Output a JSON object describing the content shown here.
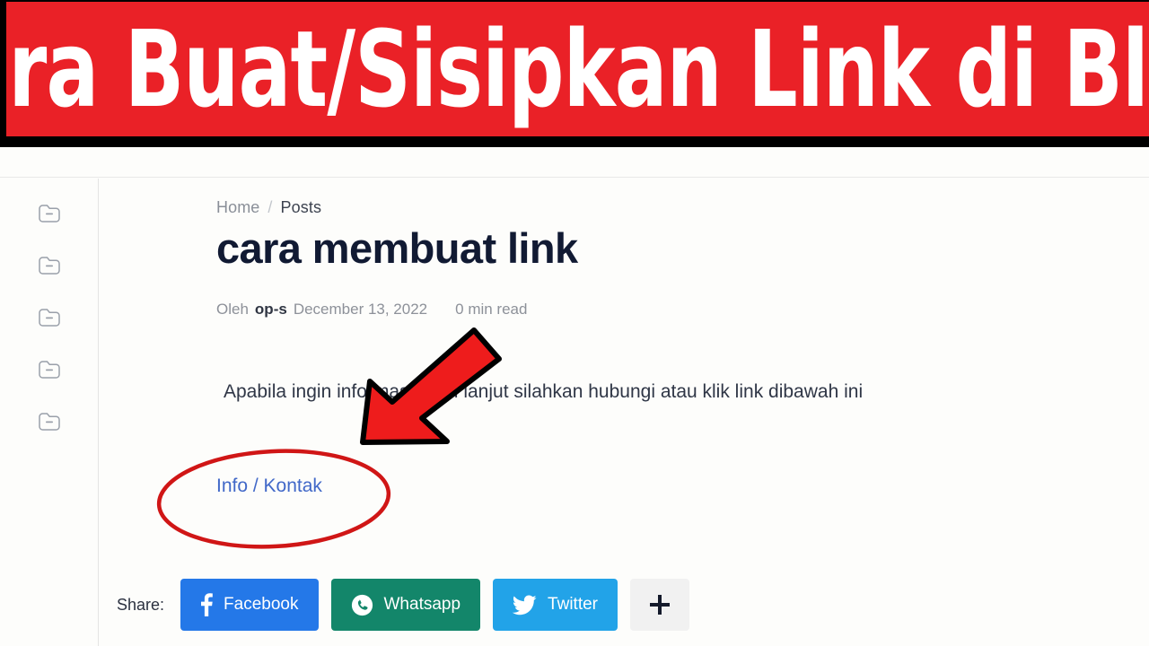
{
  "banner": {
    "text": "Cara Buat/Sisipkan Link di Blog",
    "background_color": "#ea2127",
    "text_color": "#ffffff",
    "border_color": "#000000"
  },
  "sidebar": {
    "items": [
      {
        "icon": "folder-icon"
      },
      {
        "icon": "folder-icon"
      },
      {
        "icon": "folder-icon"
      },
      {
        "icon": "folder-icon"
      },
      {
        "icon": "folder-icon"
      }
    ]
  },
  "breadcrumb": {
    "home": "Home",
    "separator": "/",
    "current": "Posts"
  },
  "post": {
    "title": "cara membuat link",
    "meta": {
      "by_label": "Oleh",
      "author": "op-s",
      "date": "December 13, 2022",
      "read_time": "0 min read"
    },
    "body": "Apabila ingin informasi lebih lanjut silahkan hubungi atau klik link dibawah ini",
    "link_text": "Info / Kontak",
    "link_color": "#4168c8"
  },
  "share": {
    "label": "Share:",
    "buttons": [
      {
        "label": "Facebook",
        "icon": "facebook-icon",
        "color": "#2478e8"
      },
      {
        "label": "Whatsapp",
        "icon": "whatsapp-icon",
        "color": "#13866a"
      },
      {
        "label": "Twitter",
        "icon": "twitter-icon",
        "color": "#22a3e8"
      },
      {
        "label": "+",
        "icon": "plus-icon",
        "color": "#f1f1f1"
      }
    ]
  },
  "annotations": {
    "arrow": {
      "shape": "arrow-down-left",
      "fill": "#ee1c1c",
      "stroke": "#000000"
    },
    "ellipse": {
      "shape": "ellipse-highlight",
      "stroke": "#d01616"
    }
  }
}
